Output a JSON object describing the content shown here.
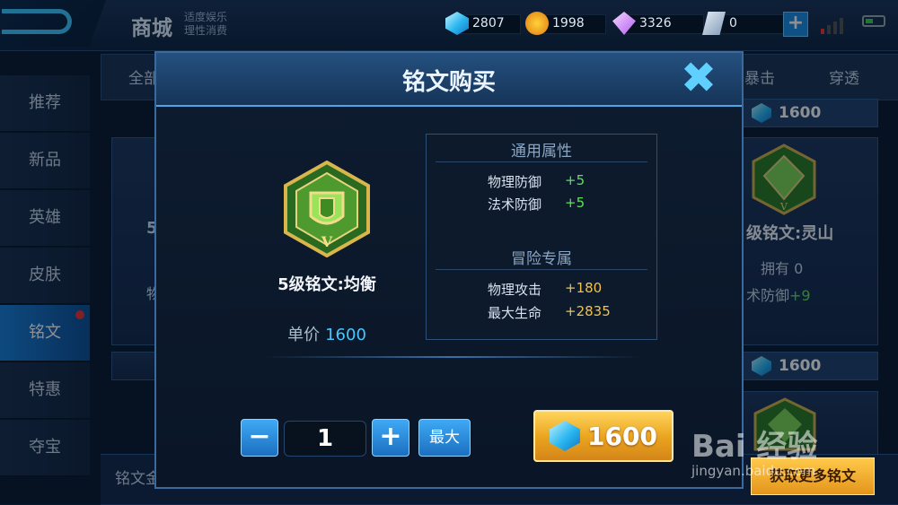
{
  "header": {
    "title": "商城",
    "subtitle_line1": "适度娱乐",
    "subtitle_line2": "理性消费"
  },
  "currencies": [
    {
      "icon": "diamond-icon",
      "value": "2807"
    },
    {
      "icon": "gold-coin-icon",
      "value": "1998"
    },
    {
      "icon": "purple-crystal-icon",
      "value": "3326"
    },
    {
      "icon": "voucher-icon",
      "value": "0"
    }
  ],
  "add_currency_label": "+",
  "sidebar": {
    "items": [
      {
        "label": "推荐"
      },
      {
        "label": "新品"
      },
      {
        "label": "英雄"
      },
      {
        "label": "皮肤"
      },
      {
        "label": "铭文"
      },
      {
        "label": "特惠"
      },
      {
        "label": "夺宝"
      }
    ]
  },
  "filter_tabs": {
    "first": "全部",
    "tab_crit": "暴击",
    "tab_pen": "穿透"
  },
  "background": {
    "top_price": "1600",
    "right_card": {
      "name": "级铭文:灵山",
      "owned": "拥有 0",
      "stat_label": "术防御",
      "stat_value": "+9"
    },
    "left_card_fragment_1": "5",
    "left_card_fragment_2": "物",
    "mid_price": "1600",
    "bottom_label": "铭文金"
  },
  "modal": {
    "title": "铭文购买",
    "close_label": "✖",
    "rune_name": "5级铭文:均衡",
    "unit_price_label": "单价",
    "unit_price_value": "1600",
    "general_header": "通用属性",
    "general_attrs": [
      {
        "key": "物理防御",
        "value": "+5"
      },
      {
        "key": "法术防御",
        "value": "+5"
      }
    ],
    "adventure_header": "冒险专属",
    "adventure_attrs": [
      {
        "key": "物理攻击",
        "value": "+180"
      },
      {
        "key": "最大生命",
        "value": "+2835"
      }
    ],
    "minus_label": "−",
    "quantity": "1",
    "plus_label": "+",
    "max_label": "最大",
    "buy_price": "1600"
  },
  "more_runes_label": "获取更多铭文",
  "watermark": {
    "text": "Bai 经验",
    "sub": "jingyan.baidu.com"
  }
}
